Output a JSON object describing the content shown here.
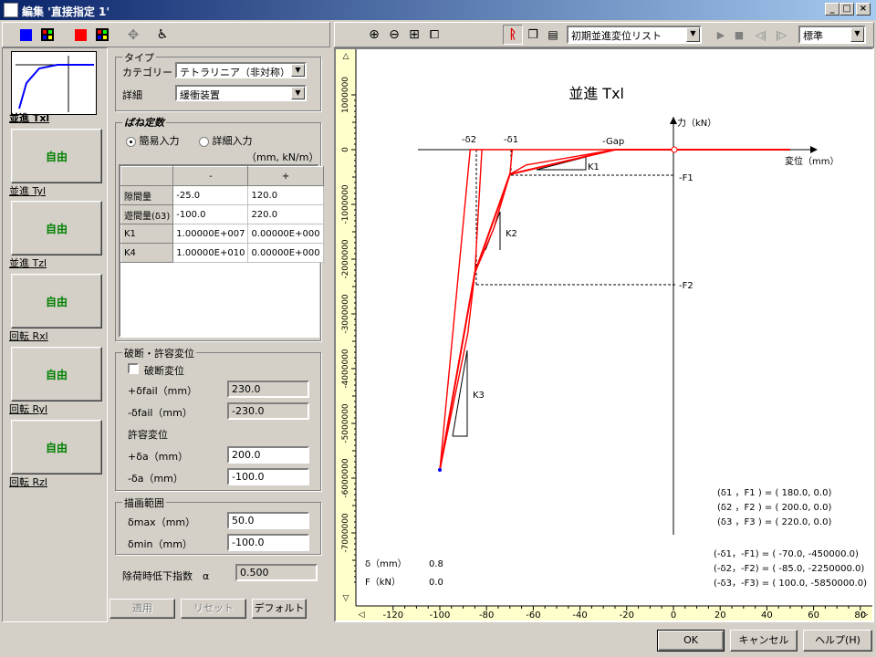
{
  "window": {
    "title": "編集 '直接指定 1'"
  },
  "left_toolbar": {
    "icons": [
      "blue-square-icon",
      "grid-color-icon",
      "red-square-icon",
      "grid-color-icon",
      "move-icon",
      "chair-icon"
    ],
    "colors": {
      "blue": "#0000ff",
      "red": "#ff0000"
    }
  },
  "dof": {
    "selected": {
      "label": "並進 Txl"
    },
    "items": [
      {
        "panel": "自由",
        "label": "並進 Tyl"
      },
      {
        "panel": "自由",
        "label": "並進 Tzl"
      },
      {
        "panel": "自由",
        "label": "回転 Rxl"
      },
      {
        "panel": "自由",
        "label": "回転 Ryl"
      },
      {
        "panel": "自由",
        "label": "回転 Rzl"
      }
    ]
  },
  "type_group": {
    "title": "タイプ",
    "category_label": "カテゴリー",
    "category_value": "テトラリニア（非対称）",
    "detail_label": "詳細",
    "detail_value": "緩衝装置"
  },
  "spring_group": {
    "title": "ばね定数",
    "radio_simple": "簡易入力",
    "radio_detail": "詳細入力",
    "units": "（mm, kN/m）",
    "col_minus": "-",
    "col_plus": "+",
    "rows": [
      {
        "name": "隙間量",
        "minus": "-25.0",
        "plus": "120.0"
      },
      {
        "name": "遊間量(δ3)",
        "minus": "-100.0",
        "plus": "220.0"
      },
      {
        "name": "K1",
        "minus": "1.00000E+007",
        "plus": "0.00000E+000"
      },
      {
        "name": "K4",
        "minus": "1.00000E+010",
        "plus": "0.00000E+000"
      }
    ]
  },
  "fail_group": {
    "title": "破断・許容変位",
    "check_label": "破断変位",
    "plus_fail_label": "+δfail（mm）",
    "plus_fail_value": "230.0",
    "minus_fail_label": "-δfail（mm）",
    "minus_fail_value": "-230.0",
    "allow_title": "許容変位",
    "plus_a_label": "+δa（mm）",
    "plus_a_value": "200.0",
    "minus_a_label": "-δa（mm）",
    "minus_a_value": "-100.0"
  },
  "range_group": {
    "title": "描画範囲",
    "max_label": "δmax（mm）",
    "max_value": "50.0",
    "min_label": "δmin（mm）",
    "min_value": "-100.0"
  },
  "unload": {
    "label": "除荷時低下指数　α",
    "value": "0.500"
  },
  "buttons": {
    "apply": "適用",
    "reset": "リセット",
    "default": "デフォルト",
    "ok": "OK",
    "cancel": "キャンセル",
    "help": "ヘルプ(H)"
  },
  "chart_toolbar": {
    "list_value": "初期並進変位リスト",
    "view_value": "標準"
  },
  "readout": {
    "delta_label": "δ（mm）",
    "delta_value": "0.8",
    "force_label": "F（kN）",
    "force_value": "0.0"
  },
  "chart_data": {
    "type": "line",
    "title": "並進 Txl",
    "xlabel": "変位（mm）",
    "ylabel": "力（kN）",
    "xlim": [
      -130,
      85
    ],
    "ylim": [
      -7400000,
      1100000
    ],
    "x_ticks": [
      "-120",
      "-100",
      "-80",
      "-60",
      "-40",
      "-20",
      "0",
      "20",
      "40",
      "60",
      "80"
    ],
    "y_ticks": [
      "1000000",
      "0",
      "-1000000",
      "-2000000",
      "-3000000",
      "-4000000",
      "-5000000",
      "-6000000",
      "-7000000"
    ],
    "series": [
      {
        "name": "",
        "points": [
          [
            0,
            0
          ],
          [
            50,
            0
          ],
          [
            -25,
            0
          ],
          [
            -70,
            -450000
          ],
          [
            -85,
            -2250000
          ],
          [
            -100,
            -5850000
          ]
        ]
      },
      {
        "name": "",
        "points": [
          [
            -100,
            -5850000
          ],
          [
            -88,
            -3350000
          ],
          [
            -85,
            -2250000
          ],
          [
            -77,
            -1450000
          ],
          [
            -70,
            -450000
          ],
          [
            -63,
            -280000
          ],
          [
            -25,
            0
          ]
        ]
      },
      {
        "name": "",
        "points": [
          [
            -100,
            -5850000
          ],
          [
            -87,
            0
          ],
          [
            -25,
            0
          ]
        ]
      },
      {
        "name": "",
        "points": [
          [
            -85,
            -2250000
          ],
          [
            -82,
            0
          ]
        ]
      },
      {
        "name": "",
        "points": [
          [
            -70,
            -450000
          ],
          [
            -69,
            0
          ]
        ]
      }
    ],
    "annotations": {
      "gap": "-Gap",
      "d1": "-δ1",
      "d2": "-δ2",
      "f1": "-F1",
      "f2": "-F2",
      "k1": "K1",
      "k2": "K2",
      "k3": "K3"
    },
    "points_table": [
      "(δ1 ，F1 ) = ( 180.0,               0.0)",
      "(δ2 ，F2 ) = ( 200.0,               0.0)",
      "(δ3 ，F3 ) = ( 220.0,               0.0)",
      "(-δ1，-F1) = ( -70.0,   -450000.0)",
      "(-δ2，-F2) = ( -85.0,  -2250000.0)",
      "(-δ3，-F3) = ( 100.0,  -5850000.0)"
    ]
  }
}
